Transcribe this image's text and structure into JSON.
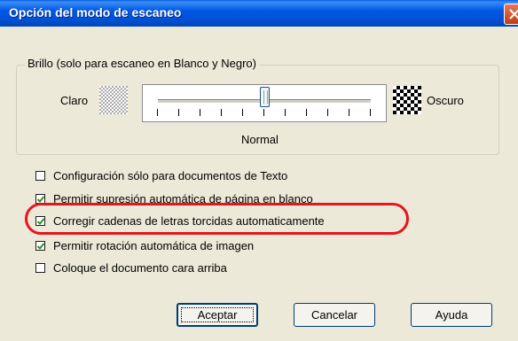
{
  "window": {
    "title": "Opción del modo de escaneo"
  },
  "brightness": {
    "group_label": "Brillo (solo para escaneo en Blanco y Negro)",
    "left_label": "Claro",
    "right_label": "Oscuro",
    "center_label": "Normal",
    "level": 0.5
  },
  "options": [
    {
      "label": "Configuración sólo para documentos de Texto",
      "checked": false
    },
    {
      "label": "Permitir supresión automática de página en blanco",
      "checked": true
    },
    {
      "label": "Corregir cadenas de letras torcidas automaticamente",
      "checked": true
    },
    {
      "label": "Permitir rotación automática de imagen",
      "checked": true
    },
    {
      "label": "Coloque el documento cara arriba",
      "checked": false
    }
  ],
  "buttons": {
    "ok": "Aceptar",
    "cancel": "Cancelar",
    "help": "Ayuda"
  },
  "colors": {
    "title_bar": "#0058e6",
    "highlight": "#e8141e",
    "face": "#ece9d8"
  }
}
